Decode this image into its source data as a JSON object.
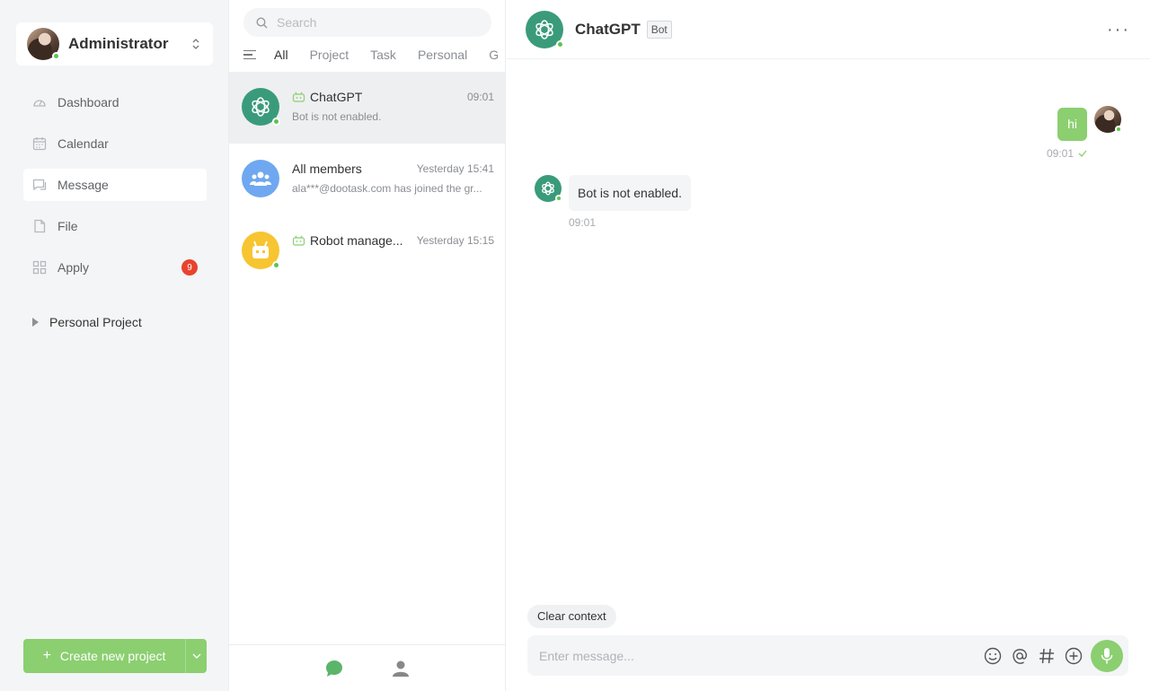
{
  "user": {
    "name": "Administrator"
  },
  "nav": {
    "items": [
      {
        "label": "Dashboard",
        "icon": "dashboard-icon"
      },
      {
        "label": "Calendar",
        "icon": "calendar-icon"
      },
      {
        "label": "Message",
        "icon": "message-icon"
      },
      {
        "label": "File",
        "icon": "file-icon"
      },
      {
        "label": "Apply",
        "icon": "apply-icon",
        "badge": "9"
      }
    ],
    "active": "Message"
  },
  "projects": {
    "section_label": "Personal Project"
  },
  "create_button": {
    "label": "Create new project"
  },
  "search": {
    "placeholder": "Search"
  },
  "filters": {
    "tabs": [
      "All",
      "Project",
      "Task",
      "Personal",
      "G"
    ],
    "active": "All"
  },
  "conversations": [
    {
      "name": "ChatGPT",
      "time": "09:01",
      "preview": "Bot is not enabled.",
      "is_bot": true
    },
    {
      "name": "All members",
      "time": "Yesterday 15:41",
      "preview": "ala***@dootask.com has joined the gr...",
      "is_bot": false
    },
    {
      "name": "Robot manage...",
      "time": "Yesterday 15:15",
      "preview": "",
      "is_bot": true
    }
  ],
  "chat": {
    "title": "ChatGPT",
    "badge": "Bot",
    "messages": [
      {
        "from": "me",
        "text": "hi",
        "time": "09:01"
      },
      {
        "from": "bot",
        "text": "Bot is not enabled.",
        "time": "09:01"
      }
    ],
    "clear_context_label": "Clear context",
    "input_placeholder": "Enter message..."
  },
  "colors": {
    "accent": "#8bcf70",
    "badge": "#e8432e",
    "gpt": "#3a9b7b"
  }
}
